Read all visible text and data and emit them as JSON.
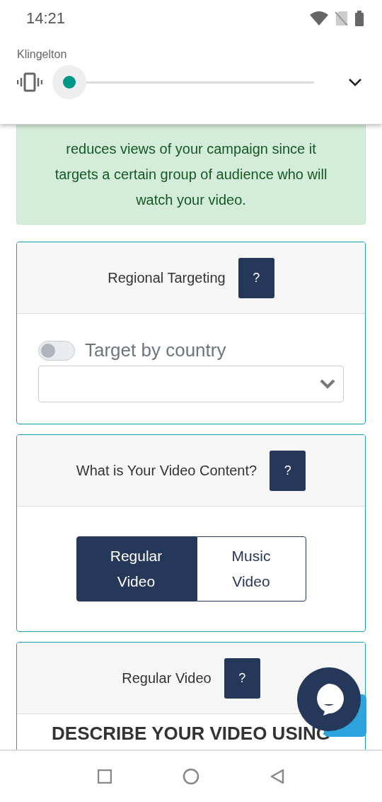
{
  "status_bar": {
    "time": "14:21"
  },
  "volume_panel": {
    "label": "Klingelton",
    "level": 0
  },
  "alert": {
    "text": "reduces views of your campaign since it targets a certain group of audience who will watch your video."
  },
  "cards": [
    {
      "kind": "toggle",
      "title": "Regional Targeting",
      "help": "?",
      "toggle": {
        "label": "Target by country",
        "on": false
      }
    },
    {
      "kind": "segmented",
      "title": "What is Your Video Content?",
      "help": "?",
      "options": [
        {
          "label": "Regular\nVideo",
          "selected": true
        },
        {
          "label": "Music\nVideo",
          "selected": false
        }
      ]
    },
    {
      "kind": "heading",
      "title": "Regular Video",
      "help": "?",
      "heading": "DESCRIBE YOUR VIDEO USING"
    }
  ]
}
